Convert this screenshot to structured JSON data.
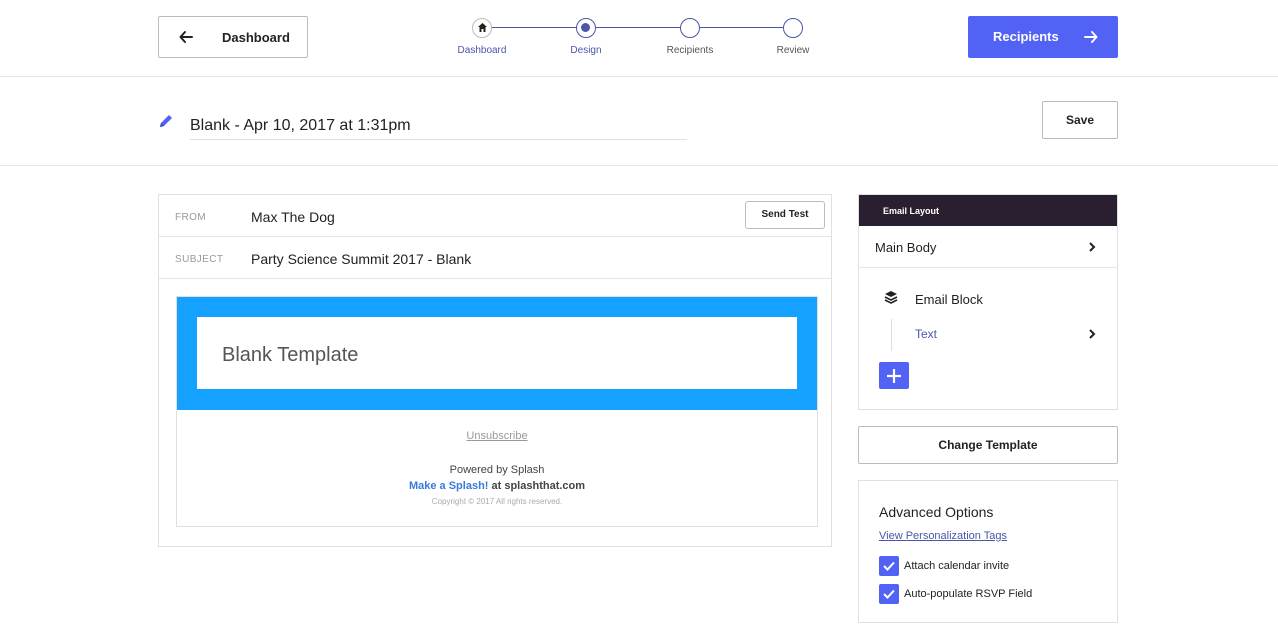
{
  "header": {
    "back_label": "Dashboard",
    "next_label": "Recipients",
    "steps": [
      {
        "label": "Dashboard"
      },
      {
        "label": "Design"
      },
      {
        "label": "Recipients"
      },
      {
        "label": "Review"
      }
    ],
    "active_step": "Design"
  },
  "title_row": {
    "campaign_name": "Blank - Apr 10, 2017 at 1:31pm",
    "save_label": "Save"
  },
  "email": {
    "from_key": "FROM",
    "from_value": "Max The Dog",
    "send_test_label": "Send Test",
    "subject_key": "SUBJECT",
    "subject_value": "Party Science Summit 2017 - Blank",
    "preview": {
      "hero_title": "Blank Template",
      "unsubscribe": "Unsubscribe",
      "powered_by": "Powered by Splash",
      "make_splash": "Make a Splash!",
      "at_site": " at splashthat.com",
      "copyright": "Copyright © 2017 All rights reserved.",
      "hero_color": "#14a1ff"
    }
  },
  "layout": {
    "header": "Email Layout",
    "main_body": "Main Body",
    "email_block": "Email Block",
    "text_item": "Text",
    "add_icon": "plus-icon",
    "header_color": "#2a1f30"
  },
  "change_template_label": "Change Template",
  "advanced": {
    "title": "Advanced Options",
    "link": "View Personalization Tags",
    "options": [
      {
        "label": "Attach calendar invite",
        "checked": true
      },
      {
        "label": "Auto-populate RSVP Field",
        "checked": true
      }
    ]
  },
  "colors": {
    "accent": "#5262f5",
    "step": "#4a56a8"
  }
}
